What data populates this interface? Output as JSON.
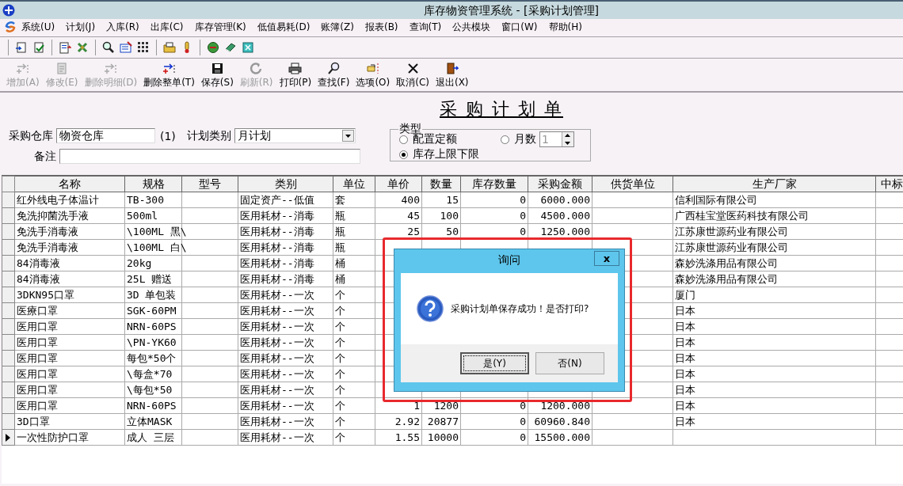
{
  "window": {
    "title": "库存物资管理系统 - [采购计划管理]"
  },
  "menu": [
    "系统(U)",
    "计划(J)",
    "入库(R)",
    "出库(C)",
    "库存管理(K)",
    "低值易耗(D)",
    "账簿(Z)",
    "报表(B)",
    "查询(T)",
    "公共模块",
    "窗口(W)",
    "帮助(H)"
  ],
  "actions": [
    {
      "label": "增加(A)",
      "disabled": true
    },
    {
      "label": "修改(E)",
      "disabled": true
    },
    {
      "label": "删除明细(D)",
      "disabled": true
    },
    {
      "label": "删除整单(T)",
      "disabled": false
    },
    {
      "label": "保存(S)",
      "disabled": false
    },
    {
      "label": "刷新(R)",
      "disabled": true
    },
    {
      "label": "打印(P)",
      "disabled": false
    },
    {
      "label": "查找(F)",
      "disabled": false
    },
    {
      "label": "选项(O)",
      "disabled": false
    },
    {
      "label": "取消(C)",
      "disabled": false
    },
    {
      "label": "退出(X)",
      "disabled": false
    }
  ],
  "form": {
    "title": "采 购 计 划 单",
    "warehouse": {
      "label": "采购仓库",
      "value": "物资仓库",
      "code": "(1)"
    },
    "plan_type": {
      "label": "计划类别",
      "value": "月计划"
    },
    "remark": {
      "label": "备注"
    },
    "type_group": {
      "label": "类型",
      "options": [
        {
          "label": "配置定额",
          "selected": false
        },
        {
          "label": "库存上限下限",
          "selected": true
        }
      ],
      "months": {
        "label": "月数",
        "selected": false,
        "value": "1",
        "disabled": true
      }
    }
  },
  "table": {
    "columns": [
      "名称",
      "规格",
      "型号",
      "类别",
      "单位",
      "单价",
      "数量",
      "库存数量",
      "采购金额",
      "供货单位",
      "生产厂家",
      "中标"
    ],
    "rows": [
      {
        "current": false,
        "cells": [
          "红外线电子体温计",
          "TB-300",
          "",
          "固定资产--低值",
          "套",
          "400",
          "15",
          "0",
          "6000.000",
          "",
          "信利国际有限公司",
          ""
        ]
      },
      {
        "current": false,
        "cells": [
          "免洗抑菌洗手液",
          "500ml",
          "",
          "医用耗材--消毒",
          "瓶",
          "45",
          "100",
          "0",
          "4500.000",
          "",
          "广西桂宝堂医药科技有限公司",
          ""
        ]
      },
      {
        "current": false,
        "cells": [
          "免洗手消毒液",
          "\\100ML 黑\\",
          "",
          "医用耗材--消毒",
          "瓶",
          "25",
          "50",
          "0",
          "1250.000",
          "",
          "江苏康世源药业有限公司",
          ""
        ]
      },
      {
        "current": false,
        "cells": [
          "免洗手消毒液",
          "\\100ML 白\\",
          "",
          "医用耗材--消毒",
          "瓶",
          "",
          "",
          "",
          "",
          "",
          "江苏康世源药业有限公司",
          ""
        ]
      },
      {
        "current": false,
        "cells": [
          "84消毒液",
          "20kg",
          "",
          "医用耗材--消毒",
          "桶",
          "",
          "",
          "",
          "",
          "",
          "森妙洗涤用品有限公司",
          ""
        ]
      },
      {
        "current": false,
        "cells": [
          "84消毒液",
          "25L 赠送",
          "",
          "医用耗材--消毒",
          "桶",
          "",
          "",
          "",
          "",
          "",
          "森妙洗涤用品有限公司",
          ""
        ]
      },
      {
        "current": false,
        "cells": [
          "3DKN95口罩",
          "3D 单包装",
          "",
          "医用耗材--一次",
          "个",
          "",
          "",
          "",
          "",
          "",
          "厦门",
          ""
        ]
      },
      {
        "current": false,
        "cells": [
          "医療口罩",
          "SGK-60PM",
          "",
          "医用耗材--一次",
          "个",
          "",
          "",
          "",
          "",
          "",
          "日本",
          ""
        ]
      },
      {
        "current": false,
        "cells": [
          "医用口罩",
          "NRN-60PS",
          "",
          "医用耗材--一次",
          "个",
          "",
          "",
          "",
          "",
          "",
          "日本",
          ""
        ]
      },
      {
        "current": false,
        "cells": [
          "医用口罩",
          "\\PN-YK60",
          "",
          "医用耗材--一次",
          "个",
          "",
          "",
          "",
          "",
          "",
          "日本",
          ""
        ]
      },
      {
        "current": false,
        "cells": [
          "医用口罩",
          "每包*50个",
          "",
          "医用耗材--一次",
          "个",
          "",
          "",
          "",
          "",
          "",
          "日本",
          ""
        ]
      },
      {
        "current": false,
        "cells": [
          "医用口罩",
          "\\每盒*70",
          "",
          "医用耗材--一次",
          "个",
          "",
          "",
          "",
          "",
          "",
          "日本",
          ""
        ]
      },
      {
        "current": false,
        "cells": [
          "医用口罩",
          "\\每包*50",
          "",
          "医用耗材--一次",
          "个",
          "",
          "",
          "",
          "",
          "",
          "日本",
          ""
        ]
      },
      {
        "current": false,
        "cells": [
          "医用口罩",
          "NRN-60PS",
          "",
          "医用耗材--一次",
          "个",
          "1",
          "1200",
          "0",
          "1200.000",
          "",
          "日本",
          ""
        ]
      },
      {
        "current": false,
        "cells": [
          "3D口罩",
          "立体MASK",
          "",
          "医用耗材--一次",
          "个",
          "2.92",
          "20877",
          "0",
          "60960.840",
          "",
          "日本",
          ""
        ]
      },
      {
        "current": true,
        "cells": [
          "一次性防护口罩",
          "成人 三层",
          "",
          "医用耗材--一次",
          "个",
          "1.55",
          "10000",
          "0",
          "15500.000",
          "",
          "",
          ""
        ]
      }
    ]
  },
  "dialog": {
    "title": "询问",
    "close": "x",
    "message": "采购计划单保存成功！是否打印?",
    "buttons": [
      {
        "label": "是(Y)",
        "focused": true
      },
      {
        "label": "否(N)",
        "focused": false
      }
    ]
  }
}
